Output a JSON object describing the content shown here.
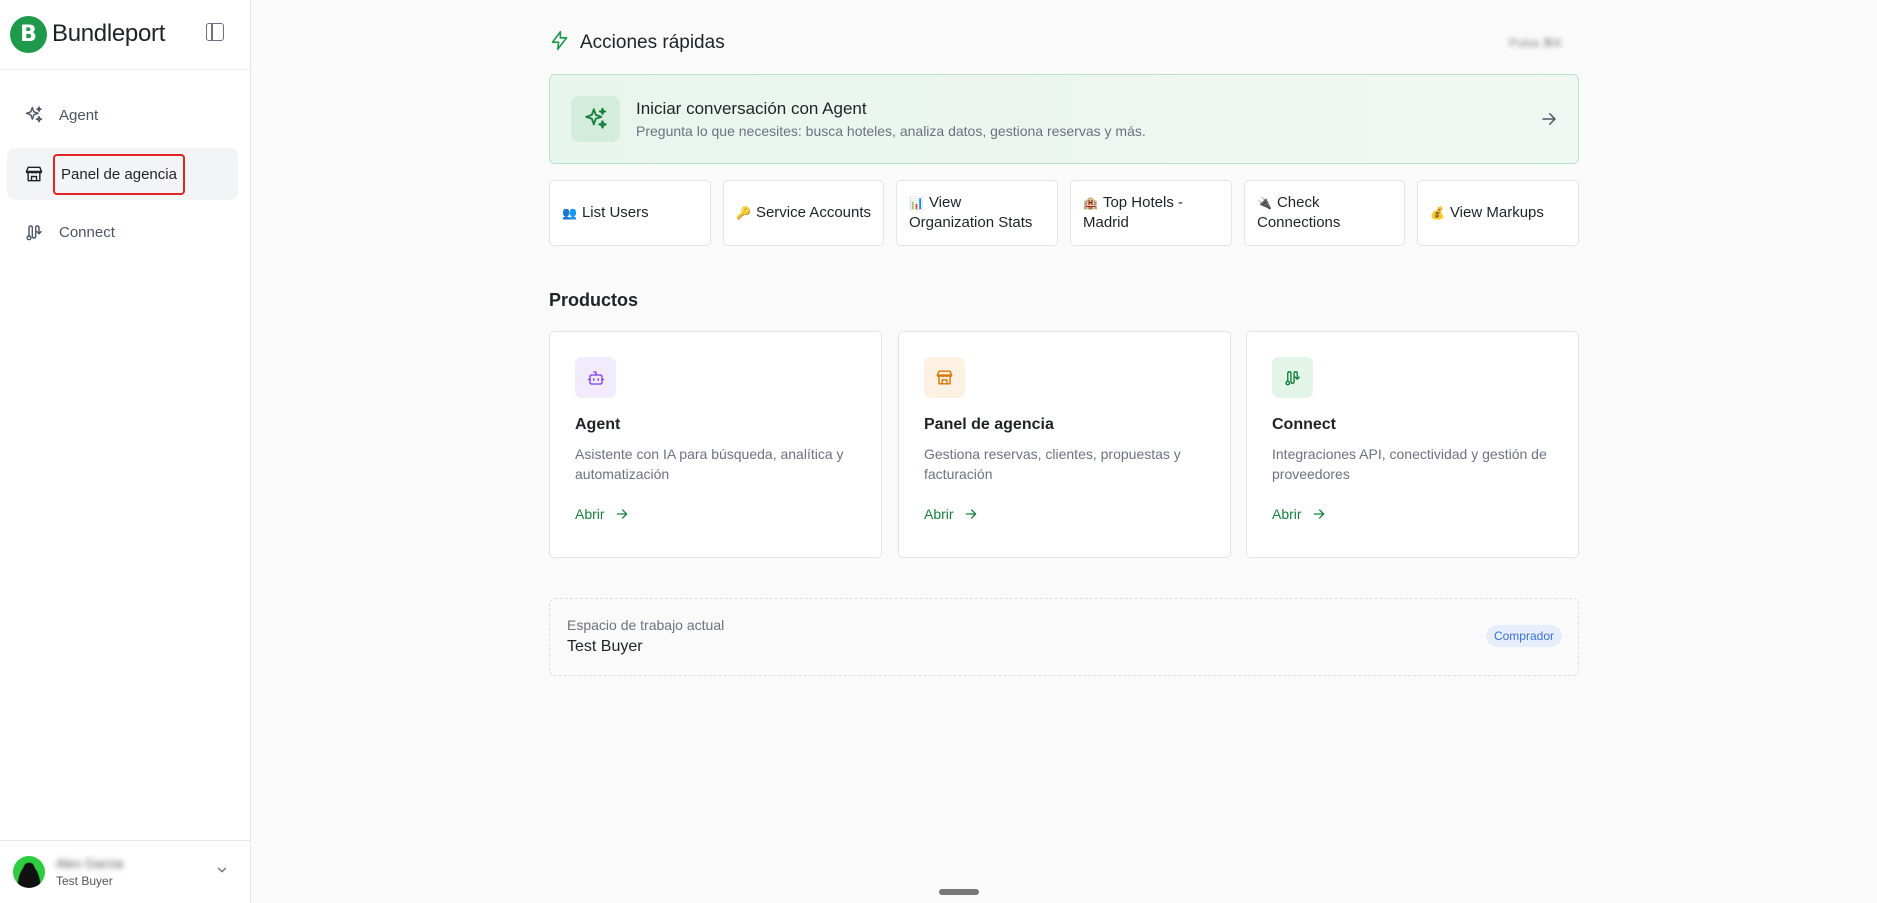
{
  "brand": {
    "logo_letter": "B",
    "name": "Bundleport"
  },
  "sidebar": {
    "items": [
      {
        "label": "Agent",
        "icon": "sparkles-icon",
        "active": false
      },
      {
        "label": "Panel de agencia",
        "icon": "store-icon",
        "active": true
      },
      {
        "label": "Connect",
        "icon": "route-icon",
        "active": false
      }
    ]
  },
  "user": {
    "name": "Alex Garcia",
    "workspace": "Test Buyer"
  },
  "quick_actions": {
    "title": "Acciones rápidas",
    "hint": "Pulsa ⌘K",
    "banner": {
      "title": "Iniciar conversación con Agent",
      "subtitle": "Pregunta lo que necesites: busca hoteles, analiza datos, gestiona reservas y más."
    },
    "buttons": [
      {
        "emoji": "👥",
        "label": "List Users"
      },
      {
        "emoji": "🔑",
        "label": "Service Accounts"
      },
      {
        "emoji": "📊",
        "label": "View Organization Stats"
      },
      {
        "emoji": "🏨",
        "label": "Top Hotels - Madrid"
      },
      {
        "emoji": "🔌",
        "label": "Check Connections"
      },
      {
        "emoji": "💰",
        "label": "View Markups"
      }
    ]
  },
  "products": {
    "title": "Productos",
    "cards": [
      {
        "title": "Agent",
        "description": "Asistente con IA para búsqueda, analítica y automatización",
        "open_label": "Abrir"
      },
      {
        "title": "Panel de agencia",
        "description": "Gestiona reservas, clientes, propuestas y facturación",
        "open_label": "Abrir"
      },
      {
        "title": "Connect",
        "description": "Integraciones API, conectividad y gestión de proveedores",
        "open_label": "Abrir"
      }
    ]
  },
  "workspace": {
    "label": "Espacio de trabajo actual",
    "name": "Test Buyer",
    "role_badge": "Comprador"
  },
  "colors": {
    "brand_green": "#1e9a4a",
    "link_green": "#17803d",
    "highlight_red": "#e02424",
    "badge_blue": "#3b6fd4"
  }
}
